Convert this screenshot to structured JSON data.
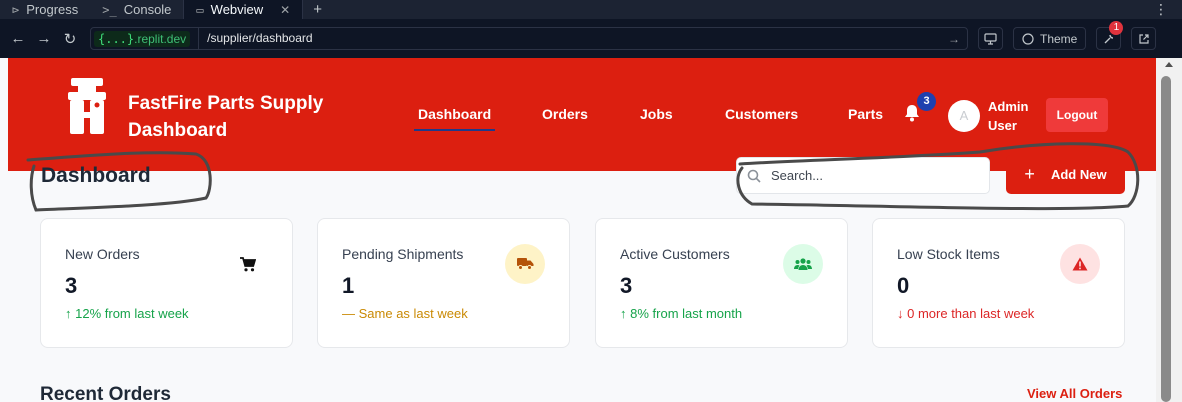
{
  "ide_tabs": [
    {
      "label": "Progress",
      "icon": "progress-icon"
    },
    {
      "label": "Console",
      "icon": "terminal-icon"
    },
    {
      "label": "Webview",
      "icon": "monitor-icon",
      "active": true
    }
  ],
  "browser": {
    "host_tag": "{...}",
    "host": ".replit.dev",
    "path": "/supplier/dashboard",
    "theme_label": "Theme",
    "devtools_badge": "1"
  },
  "header": {
    "brand_line1": "FastFire Parts Supply",
    "brand_line2": "Dashboard",
    "nav": [
      "Dashboard",
      "Orders",
      "Jobs",
      "Customers",
      "Parts"
    ],
    "active_nav": "Dashboard",
    "notifications": "3",
    "avatar_letter": "A",
    "user_line1": "Admin",
    "user_line2": "User",
    "logout_label": "Logout"
  },
  "page": {
    "title": "Dashboard",
    "search_placeholder": "Search...",
    "add_label": "Add New"
  },
  "stats": [
    {
      "label": "New Orders",
      "value": "3",
      "trend": "12% from last week",
      "direction": "up",
      "icon": "cart-icon"
    },
    {
      "label": "Pending Shipments",
      "value": "1",
      "trend": "Same as last week",
      "direction": "flat",
      "icon": "truck-icon"
    },
    {
      "label": "Active Customers",
      "value": "3",
      "trend": "8% from last month",
      "direction": "up",
      "icon": "users-icon"
    },
    {
      "label": "Low Stock Items",
      "value": "0",
      "trend": "0 more than last week",
      "direction": "down",
      "icon": "warning-icon"
    }
  ],
  "recent_orders": {
    "title": "Recent Orders",
    "view_all": "View All Orders"
  },
  "colors": {
    "brand_red": "#dc1f10",
    "nav_underline": "#1e3a8a",
    "trend_up": "#16a34a",
    "trend_flat": "#ca8a04",
    "trend_down": "#dc2626"
  }
}
